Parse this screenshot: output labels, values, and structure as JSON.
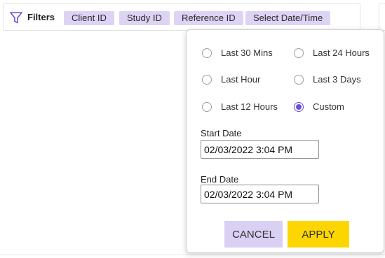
{
  "filters": {
    "label": "Filters",
    "chips": [
      "Client ID",
      "Study ID",
      "Reference ID",
      "Select Date/Time"
    ]
  },
  "time_options": [
    {
      "label": "Last 30 Mins",
      "checked": false
    },
    {
      "label": "Last 24 Hours",
      "checked": false
    },
    {
      "label": "Last Hour",
      "checked": false
    },
    {
      "label": "Last 3 Days",
      "checked": false
    },
    {
      "label": "Last 12 Hours",
      "checked": false
    },
    {
      "label": "Custom",
      "checked": true
    }
  ],
  "start_date": {
    "label": "Start Date",
    "value": "02/03/2022 3:04 PM"
  },
  "end_date": {
    "label": "End Date",
    "value": "02/03/2022 3:04 PM"
  },
  "buttons": {
    "cancel": "CANCEL",
    "apply": "APPLY"
  },
  "colors": {
    "accent": "#6c4fd8",
    "chip_bg": "#dcd3f5",
    "apply_bg": "#fdd500",
    "cancel_bg": "#d9d0f4"
  }
}
